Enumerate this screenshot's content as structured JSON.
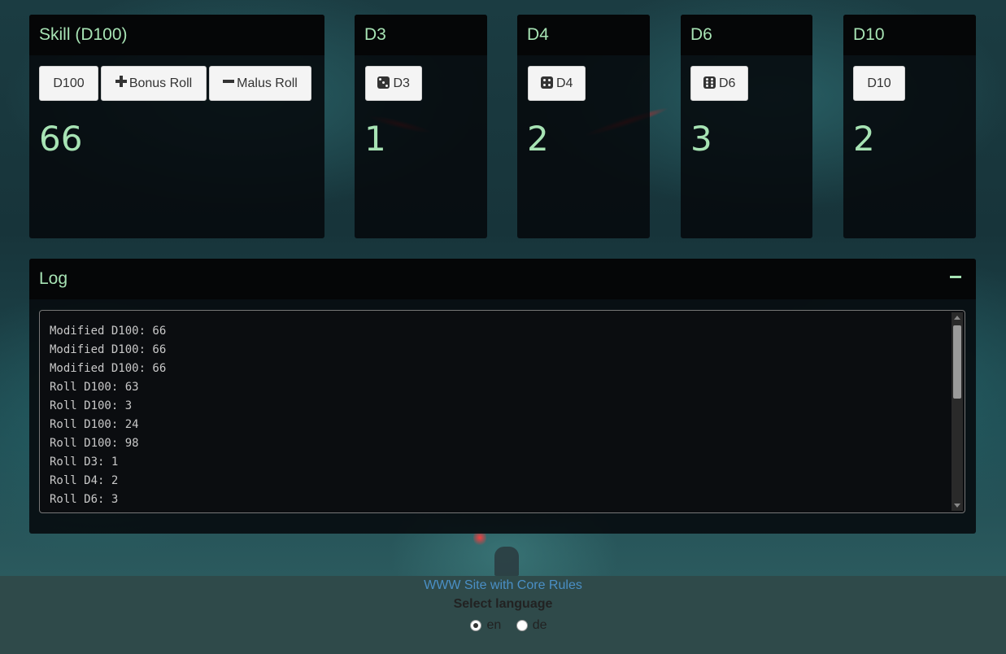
{
  "panels": {
    "skill": {
      "title": "Skill (D100)",
      "result": "66",
      "buttons": {
        "d100": "D100",
        "bonus": "Bonus Roll",
        "malus": "Malus Roll"
      }
    },
    "d3": {
      "title": "D3",
      "button": "D3",
      "result": "1"
    },
    "d4": {
      "title": "D4",
      "button": "D4",
      "result": "2"
    },
    "d6": {
      "title": "D6",
      "button": "D6",
      "result": "3"
    },
    "d10": {
      "title": "D10",
      "button": "D10",
      "result": "2"
    }
  },
  "log": {
    "title": "Log",
    "lines": [
      "Modified D100: 66",
      "Modified D100: 66",
      "Modified D100: 66",
      "Roll D100: 63",
      "Roll D100: 3",
      "Roll D100: 24",
      "Roll D100: 98",
      "Roll D3: 1",
      "Roll D4: 2",
      "Roll D6: 3"
    ]
  },
  "footer": {
    "link": "WWW Site with Core Rules",
    "select_language": "Select language",
    "languages": [
      {
        "label": "en",
        "selected": true
      },
      {
        "label": "de",
        "selected": false
      }
    ]
  },
  "colors": {
    "accent": "#a7e3b4",
    "link": "#4a8fc5",
    "footer_bg": "#2f4a4a"
  }
}
